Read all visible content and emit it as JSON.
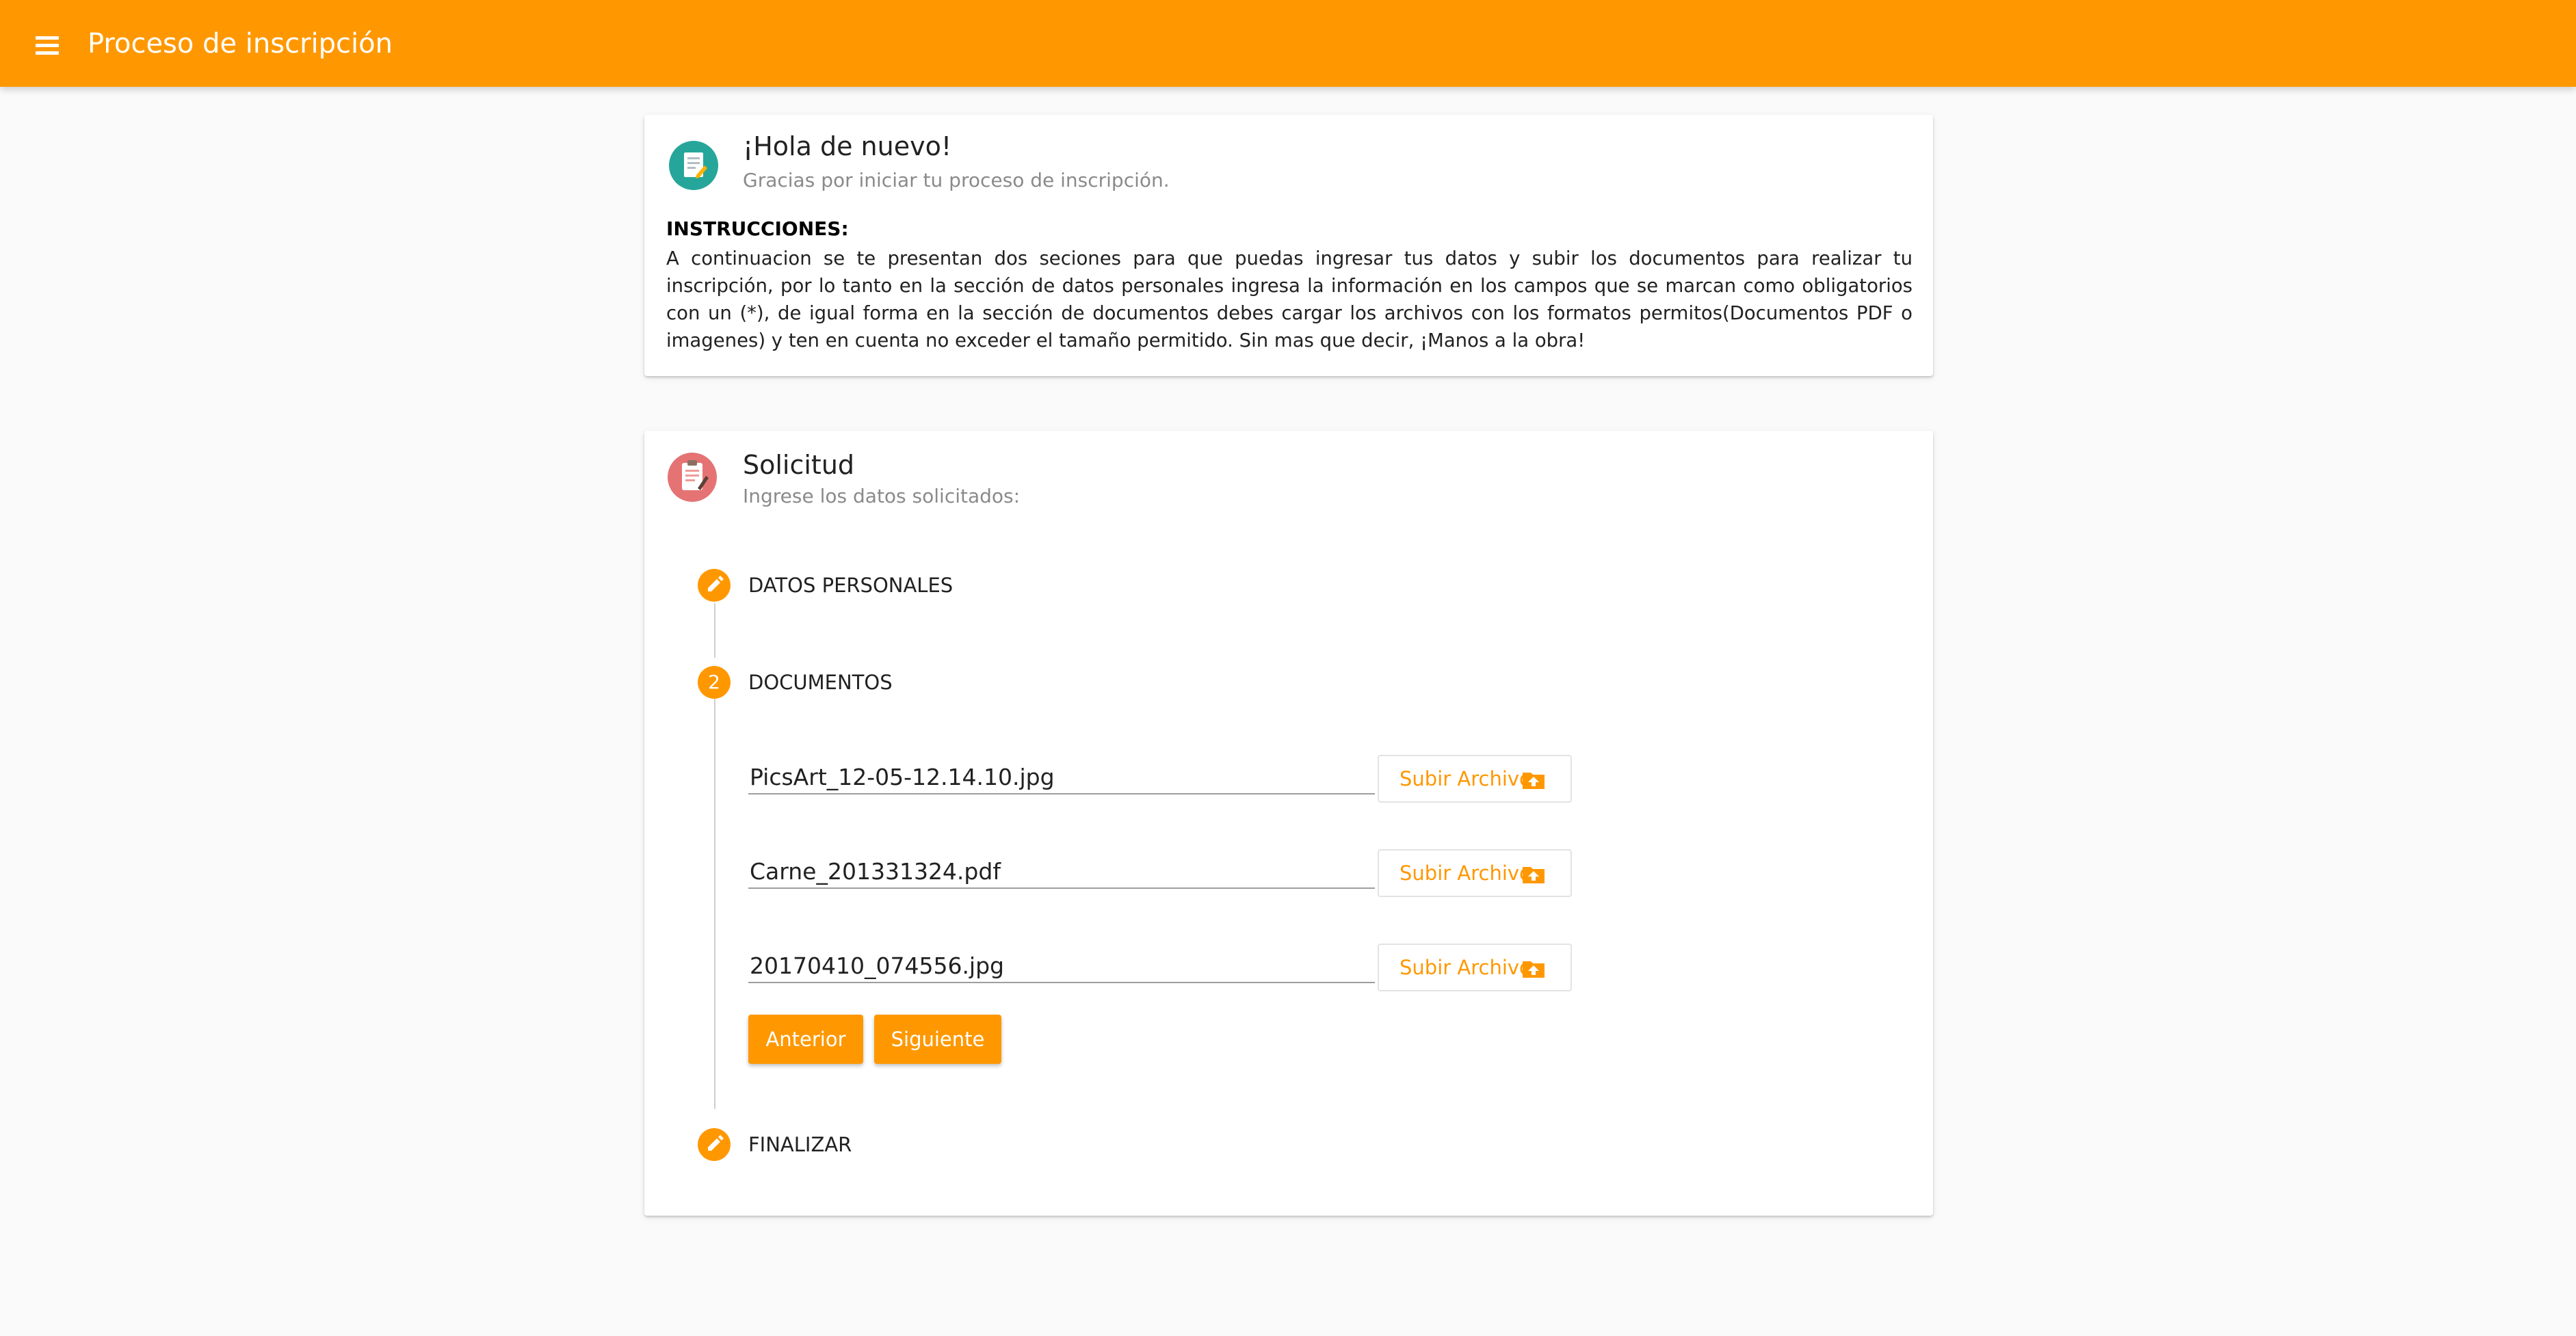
{
  "appbar": {
    "title": "Proceso de inscripción",
    "menu_icon": "menu-icon",
    "color": "#ff9800"
  },
  "welcome_card": {
    "icon": "document-edit-icon",
    "title": "¡Hola de nuevo!",
    "subtitle": "Gracias por iniciar tu proceso de inscripción.",
    "instructions_heading": "INSTRUCCIONES:",
    "instructions_text": "A continuacion se te presentan dos seciones para que puedas ingresar tus datos y subir los documentos para realizar tu inscripción, por lo tanto en la sección de datos personales ingresa la información en los campos que se marcan como obligatorios con un (*), de igual forma en la sección de documentos debes cargar los archivos con los formatos permitos(Documentos PDF o imagenes) y ten en cuenta no exceder el tamaño permitido. Sin mas que decir, ¡Manos a la obra!"
  },
  "request_card": {
    "icon": "clipboard-icon",
    "title": "Solicitud",
    "subtitle": "Ingrese los datos solicitados:"
  },
  "stepper": {
    "steps": [
      {
        "label": "DATOS PERSONALES",
        "marker": "",
        "icon": "edit-icon"
      },
      {
        "label": "DOCUMENTOS",
        "marker": "2",
        "icon": ""
      },
      {
        "label": "FINALIZAR",
        "marker": "",
        "icon": "edit-icon"
      }
    ]
  },
  "documents": {
    "files": [
      {
        "value": "PicsArt_12-05-12.14.10.jpg",
        "button_label": "Subir Archivo"
      },
      {
        "value": "Carne_201331324.pdf",
        "button_label": "Subir Archivo"
      },
      {
        "value": "20170410_074556.jpg",
        "button_label": "Subir Archivo"
      }
    ],
    "upload_icon": "upload-icon",
    "prev_label": "Anterior",
    "next_label": "Siguiente"
  }
}
